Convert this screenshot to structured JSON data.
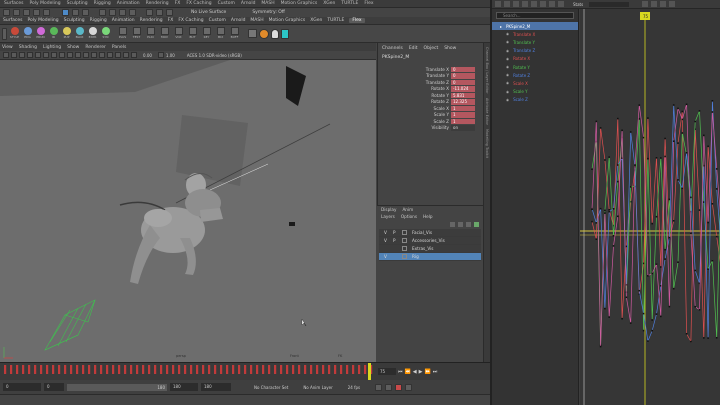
{
  "menubar": [
    "Surfaces",
    "Poly Modeling",
    "Sculpting",
    "Rigging",
    "Animation",
    "Rendering",
    "FX",
    "FX Caching",
    "Custom",
    "Arnold",
    "MASH",
    "Motion Graphics",
    "XGen",
    "TURTLE",
    "Flex"
  ],
  "menubar_active": "Flex",
  "shelf": {
    "items": [
      {
        "label": "STYLE",
        "color": "#c84a3a"
      },
      {
        "label": "EDG",
        "color": "#6a9ad8"
      },
      {
        "label": "PRUN",
        "color": "#d06ad8"
      },
      {
        "label": "IR",
        "color": "#5ab85a"
      },
      {
        "label": "PUP",
        "color": "#d8c85a"
      },
      {
        "label": "BLOX",
        "color": "#5ab8c8"
      },
      {
        "label": "EXPR",
        "color": "#d8d8d8"
      },
      {
        "label": "SYN",
        "color": "#7ad87a"
      }
    ],
    "text_labels": [
      "PLUS",
      "TEST",
      "PLIO",
      "MOV",
      "VOX",
      "BUT",
      "KEY",
      "MIX",
      "BUFF"
    ]
  },
  "toolbar": {
    "no_live_surface": "No Live Surface",
    "symmetry": "Symmetry: Off"
  },
  "viewport": {
    "menu": [
      "View",
      "Shading",
      "Lighting",
      "Show",
      "Renderer",
      "Panels"
    ],
    "values": [
      "0.00",
      "1.00"
    ],
    "colorspace": "ACES 1.0 SDR-video (sRGB)",
    "bottom_labels": [
      "persp",
      "Front",
      "FK"
    ]
  },
  "channel_box": {
    "tabs": [
      "Channels",
      "Edit",
      "Object",
      "Show"
    ],
    "object": "PKSpine2_M",
    "channels": [
      {
        "name": "Translate X",
        "value": "0"
      },
      {
        "name": "Translate Y",
        "value": "0"
      },
      {
        "name": "Translate Z",
        "value": "0"
      },
      {
        "name": "Rotate X",
        "value": "-11.024"
      },
      {
        "name": "Rotate Y",
        "value": "5.831"
      },
      {
        "name": "Rotate Z",
        "value": "12.325"
      },
      {
        "name": "Scale X",
        "value": "1"
      },
      {
        "name": "Scale Y",
        "value": "1"
      },
      {
        "name": "Scale Z",
        "value": "1"
      },
      {
        "name": "Visibility",
        "value": "on"
      }
    ],
    "side_tabs": [
      "Channel Box / Layer Editor",
      "Attribute Editor",
      "Modelling Toolkit"
    ]
  },
  "layer_editor": {
    "tabs": [
      "Display",
      "Anim"
    ],
    "menu": [
      "Layers",
      "Options",
      "Help"
    ],
    "layers": [
      {
        "v": "V",
        "p": "P",
        "name": "Facial_Vis",
        "selected": false
      },
      {
        "v": "V",
        "p": "P",
        "name": "Accessories_Vis",
        "selected": false
      },
      {
        "v": "",
        "p": "",
        "name": "Extras_Vis",
        "selected": false
      },
      {
        "v": "V",
        "p": "",
        "name": "Rig",
        "selected": true
      }
    ]
  },
  "range": {
    "start": "0",
    "anim_start": "0",
    "anim_end": "180",
    "end": "180",
    "end2": "180",
    "current_frame": "75",
    "character_set": "No Character Set",
    "anim_layer": "No Anim Layer",
    "fps": "24 fps"
  },
  "graph_editor": {
    "search_placeholder": "Search...",
    "stats": "Stats",
    "frame_marker": "75",
    "object": "PKSpine2_M",
    "curves": [
      {
        "name": "Translate X",
        "color": "#e05050"
      },
      {
        "name": "Translate Y",
        "color": "#50c050"
      },
      {
        "name": "Translate Z",
        "color": "#5080e0"
      },
      {
        "name": "Rotate X",
        "color": "#e05050"
      },
      {
        "name": "Rotate Y",
        "color": "#50c050"
      },
      {
        "name": "Rotate Z",
        "color": "#5080e0"
      },
      {
        "name": "Scale X",
        "color": "#e05050"
      },
      {
        "name": "Scale Y",
        "color": "#50c050"
      },
      {
        "name": "Scale Z",
        "color": "#5080e0"
      }
    ]
  },
  "colors": {
    "keyed": "#b4575f",
    "selection": "#5284b8",
    "playhead": "#d8d820"
  }
}
